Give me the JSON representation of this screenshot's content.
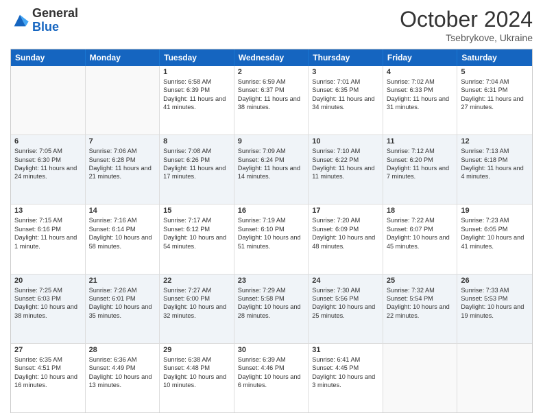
{
  "header": {
    "logo": {
      "line1": "General",
      "line2": "Blue"
    },
    "month": "October 2024",
    "location": "Tsebrykove, Ukraine"
  },
  "weekdays": [
    "Sunday",
    "Monday",
    "Tuesday",
    "Wednesday",
    "Thursday",
    "Friday",
    "Saturday"
  ],
  "rows": [
    {
      "alt": false,
      "cells": [
        {
          "day": "",
          "empty": true
        },
        {
          "day": "",
          "empty": true
        },
        {
          "day": "1",
          "sunrise": "6:58 AM",
          "sunset": "6:39 PM",
          "daylight": "11 hours and 41 minutes."
        },
        {
          "day": "2",
          "sunrise": "6:59 AM",
          "sunset": "6:37 PM",
          "daylight": "11 hours and 38 minutes."
        },
        {
          "day": "3",
          "sunrise": "7:01 AM",
          "sunset": "6:35 PM",
          "daylight": "11 hours and 34 minutes."
        },
        {
          "day": "4",
          "sunrise": "7:02 AM",
          "sunset": "6:33 PM",
          "daylight": "11 hours and 31 minutes."
        },
        {
          "day": "5",
          "sunrise": "7:04 AM",
          "sunset": "6:31 PM",
          "daylight": "11 hours and 27 minutes."
        }
      ]
    },
    {
      "alt": true,
      "cells": [
        {
          "day": "6",
          "sunrise": "7:05 AM",
          "sunset": "6:30 PM",
          "daylight": "11 hours and 24 minutes."
        },
        {
          "day": "7",
          "sunrise": "7:06 AM",
          "sunset": "6:28 PM",
          "daylight": "11 hours and 21 minutes."
        },
        {
          "day": "8",
          "sunrise": "7:08 AM",
          "sunset": "6:26 PM",
          "daylight": "11 hours and 17 minutes."
        },
        {
          "day": "9",
          "sunrise": "7:09 AM",
          "sunset": "6:24 PM",
          "daylight": "11 hours and 14 minutes."
        },
        {
          "day": "10",
          "sunrise": "7:10 AM",
          "sunset": "6:22 PM",
          "daylight": "11 hours and 11 minutes."
        },
        {
          "day": "11",
          "sunrise": "7:12 AM",
          "sunset": "6:20 PM",
          "daylight": "11 hours and 7 minutes."
        },
        {
          "day": "12",
          "sunrise": "7:13 AM",
          "sunset": "6:18 PM",
          "daylight": "11 hours and 4 minutes."
        }
      ]
    },
    {
      "alt": false,
      "cells": [
        {
          "day": "13",
          "sunrise": "7:15 AM",
          "sunset": "6:16 PM",
          "daylight": "11 hours and 1 minute."
        },
        {
          "day": "14",
          "sunrise": "7:16 AM",
          "sunset": "6:14 PM",
          "daylight": "10 hours and 58 minutes."
        },
        {
          "day": "15",
          "sunrise": "7:17 AM",
          "sunset": "6:12 PM",
          "daylight": "10 hours and 54 minutes."
        },
        {
          "day": "16",
          "sunrise": "7:19 AM",
          "sunset": "6:10 PM",
          "daylight": "10 hours and 51 minutes."
        },
        {
          "day": "17",
          "sunrise": "7:20 AM",
          "sunset": "6:09 PM",
          "daylight": "10 hours and 48 minutes."
        },
        {
          "day": "18",
          "sunrise": "7:22 AM",
          "sunset": "6:07 PM",
          "daylight": "10 hours and 45 minutes."
        },
        {
          "day": "19",
          "sunrise": "7:23 AM",
          "sunset": "6:05 PM",
          "daylight": "10 hours and 41 minutes."
        }
      ]
    },
    {
      "alt": true,
      "cells": [
        {
          "day": "20",
          "sunrise": "7:25 AM",
          "sunset": "6:03 PM",
          "daylight": "10 hours and 38 minutes."
        },
        {
          "day": "21",
          "sunrise": "7:26 AM",
          "sunset": "6:01 PM",
          "daylight": "10 hours and 35 minutes."
        },
        {
          "day": "22",
          "sunrise": "7:27 AM",
          "sunset": "6:00 PM",
          "daylight": "10 hours and 32 minutes."
        },
        {
          "day": "23",
          "sunrise": "7:29 AM",
          "sunset": "5:58 PM",
          "daylight": "10 hours and 28 minutes."
        },
        {
          "day": "24",
          "sunrise": "7:30 AM",
          "sunset": "5:56 PM",
          "daylight": "10 hours and 25 minutes."
        },
        {
          "day": "25",
          "sunrise": "7:32 AM",
          "sunset": "5:54 PM",
          "daylight": "10 hours and 22 minutes."
        },
        {
          "day": "26",
          "sunrise": "7:33 AM",
          "sunset": "5:53 PM",
          "daylight": "10 hours and 19 minutes."
        }
      ]
    },
    {
      "alt": false,
      "cells": [
        {
          "day": "27",
          "sunrise": "6:35 AM",
          "sunset": "4:51 PM",
          "daylight": "10 hours and 16 minutes."
        },
        {
          "day": "28",
          "sunrise": "6:36 AM",
          "sunset": "4:49 PM",
          "daylight": "10 hours and 13 minutes."
        },
        {
          "day": "29",
          "sunrise": "6:38 AM",
          "sunset": "4:48 PM",
          "daylight": "10 hours and 10 minutes."
        },
        {
          "day": "30",
          "sunrise": "6:39 AM",
          "sunset": "4:46 PM",
          "daylight": "10 hours and 6 minutes."
        },
        {
          "day": "31",
          "sunrise": "6:41 AM",
          "sunset": "4:45 PM",
          "daylight": "10 hours and 3 minutes."
        },
        {
          "day": "",
          "empty": true
        },
        {
          "day": "",
          "empty": true
        }
      ]
    }
  ]
}
